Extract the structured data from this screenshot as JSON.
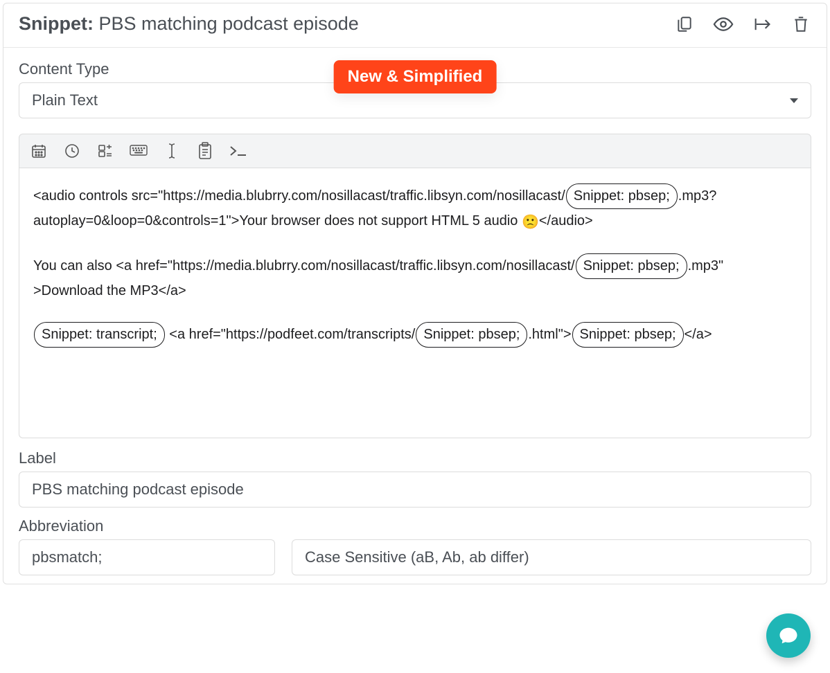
{
  "header": {
    "prefix": "Snippet:",
    "name": "PBS matching podcast episode"
  },
  "badge": "New & Simplified",
  "content_type": {
    "label": "Content Type",
    "value": "Plain Text"
  },
  "editor": {
    "p1_a": "<audio controls src=\"https://media.blubrry.com/nosillacast/traffic.libsyn.com/nosillacast/",
    "pill_pbsep": "Snippet: pbsep;",
    "p1_b": ".mp3?autoplay=0&loop=0&controls=1\">Your browser does not support HTML 5 audio ",
    "emoji": "🙁",
    "p1_c": "</audio>",
    "p2_a": "You can also <a href=\"https://media.blubrry.com/nosillacast/traffic.libsyn.com/nosillacast/",
    "p2_b": ".mp3\" >Download the MP3</a>",
    "pill_transcript": "Snippet: transcript;",
    "p3_a": " <a href=\"https://podfeet.com/transcripts/",
    "p3_b": ".html\">",
    "p3_c": "</a>"
  },
  "label_field": {
    "label": "Label",
    "value": "PBS matching podcast episode"
  },
  "abbreviation": {
    "label": "Abbreviation",
    "value": "pbsmatch;"
  },
  "case": {
    "value": "Case Sensitive (aB, Ab, ab differ)"
  }
}
